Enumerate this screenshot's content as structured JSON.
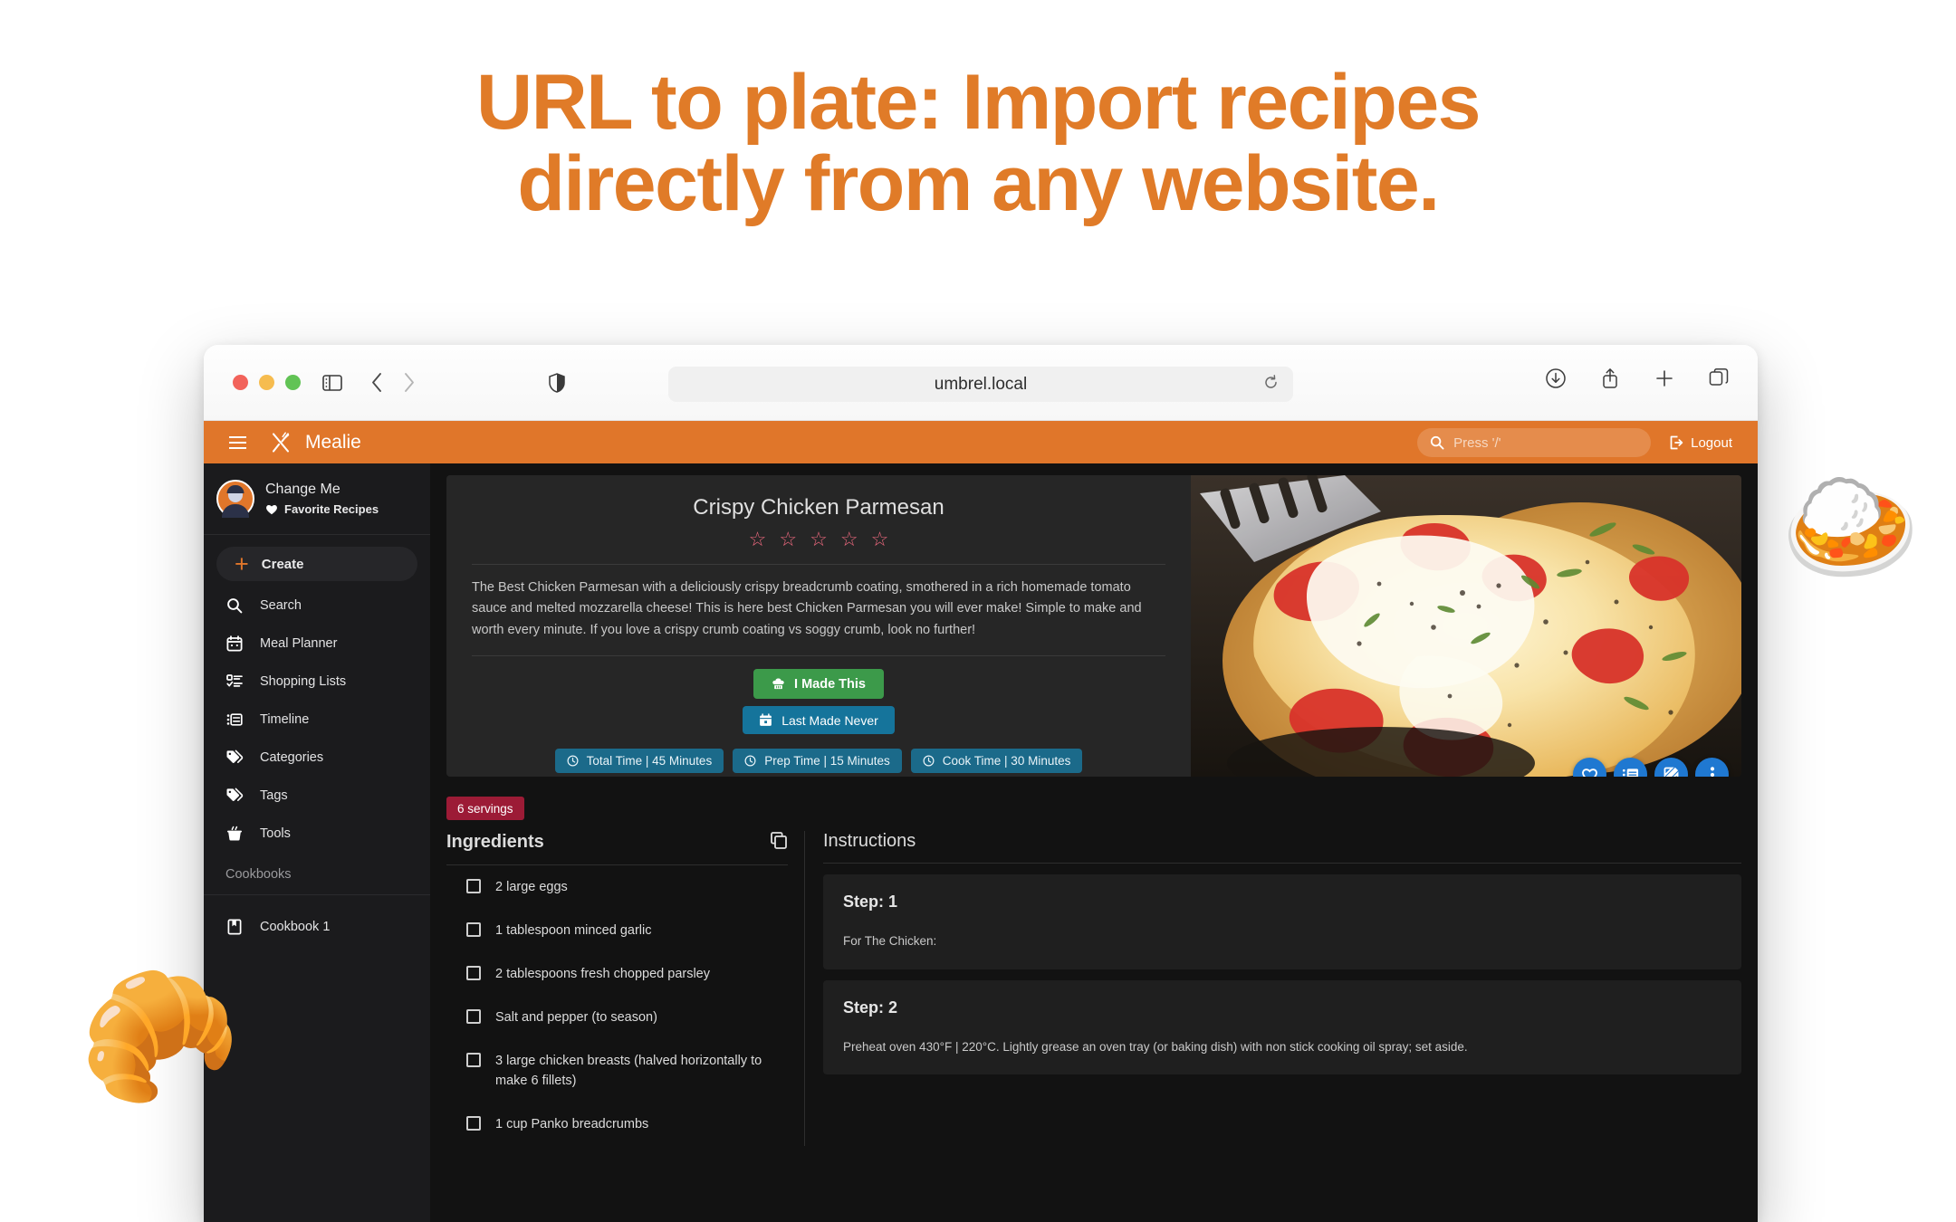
{
  "headline": {
    "line1": "URL to plate: Import recipes",
    "line2": "directly from any website.",
    "color": "#e07b28"
  },
  "browser": {
    "url": "umbrel.local",
    "traffic_lights": [
      "close-red",
      "minimize-yellow",
      "maximize-green"
    ],
    "left_icons": [
      "sidebar-toggle-icon",
      "back-arrow-icon",
      "forward-arrow-icon",
      "shield-icon"
    ],
    "url_icons": [
      "reload-icon"
    ],
    "right_icons": [
      "downloads-icon",
      "share-icon",
      "new-tab-icon",
      "tab-overview-icon"
    ]
  },
  "app": {
    "brand": "Mealie",
    "brand_icon": "fork-knife-icon",
    "menu_icon": "hamburger-menu-icon",
    "accent": "#e0762a",
    "search": {
      "placeholder": "Press '/'",
      "icon": "search-icon"
    },
    "logout": {
      "label": "Logout",
      "icon": "logout-icon"
    }
  },
  "sidebar": {
    "profile": {
      "name": "Change Me",
      "favorites_label": "Favorite Recipes",
      "favorites_icon": "heart-icon",
      "avatar": "user-avatar"
    },
    "create": {
      "label": "Create",
      "icon": "plus-icon"
    },
    "items": [
      {
        "label": "Search",
        "icon": "search-icon"
      },
      {
        "label": "Meal Planner",
        "icon": "calendar-icon"
      },
      {
        "label": "Shopping Lists",
        "icon": "checklist-icon"
      },
      {
        "label": "Timeline",
        "icon": "timeline-icon"
      },
      {
        "label": "Categories",
        "icon": "tags-icon"
      },
      {
        "label": "Tags",
        "icon": "tags-icon"
      },
      {
        "label": "Tools",
        "icon": "pot-icon"
      }
    ],
    "section_label": "Cookbooks",
    "cookbooks": [
      {
        "label": "Cookbook 1",
        "icon": "book-icon"
      }
    ]
  },
  "recipe": {
    "title": "Crispy Chicken Parmesan",
    "rating": {
      "stars": 5,
      "filled": 0,
      "color": "#e8677c"
    },
    "description": "The Best Chicken Parmesan with a deliciously crispy breadcrumb coating, smothered in a rich homemade tomato sauce and melted mozzarella cheese! This is here best Chicken Parmesan you will ever make! Simple to make and worth every minute. If you love a crispy crumb coating vs soggy crumb, look no further!",
    "made_button": {
      "label": "I Made This",
      "icon": "chef-hat-icon",
      "color": "#3c9a4a"
    },
    "last_made_button": {
      "label": "Last Made Never",
      "icon": "calendar-icon",
      "color": "#15749b"
    },
    "time_chips": [
      {
        "label": "Total Time | 45 Minutes",
        "icon": "clock-icon"
      },
      {
        "label": "Prep Time | 15 Minutes",
        "icon": "clock-icon"
      },
      {
        "label": "Cook Time | 30 Minutes",
        "icon": "clock-icon"
      }
    ],
    "servings": "6 servings",
    "photo_alt": "crispy-chicken-parmesan-photo",
    "fabs": [
      {
        "name": "favorite-fab",
        "icon": "heart-icon"
      },
      {
        "name": "timeline-fab",
        "icon": "list-note-icon"
      },
      {
        "name": "edit-fab",
        "icon": "edit-icon"
      },
      {
        "name": "more-fab",
        "icon": "more-vertical-icon"
      }
    ],
    "ingredients_section": {
      "title": "Ingredients",
      "copy_icon": "copy-icon"
    },
    "ingredients": [
      "2 large eggs",
      "1 tablespoon minced garlic",
      "2 tablespoons fresh chopped parsley",
      "Salt and pepper (to season)",
      "3 large chicken breasts (halved horizontally to make 6 fillets)",
      "1 cup Panko breadcrumbs"
    ],
    "instructions_section": {
      "title": "Instructions"
    },
    "instructions": [
      {
        "title": "Step: 1",
        "body": "For The Chicken:"
      },
      {
        "title": "Step: 2",
        "body": "Preheat oven 430°F | 220°C. Lightly grease an oven tray (or baking dish) with non stick cooking oil spray; set aside."
      }
    ]
  },
  "decorations": [
    {
      "name": "curry-rice-emoji",
      "glyph": "🍛"
    },
    {
      "name": "croissant-emoji",
      "glyph": "🥐"
    }
  ]
}
